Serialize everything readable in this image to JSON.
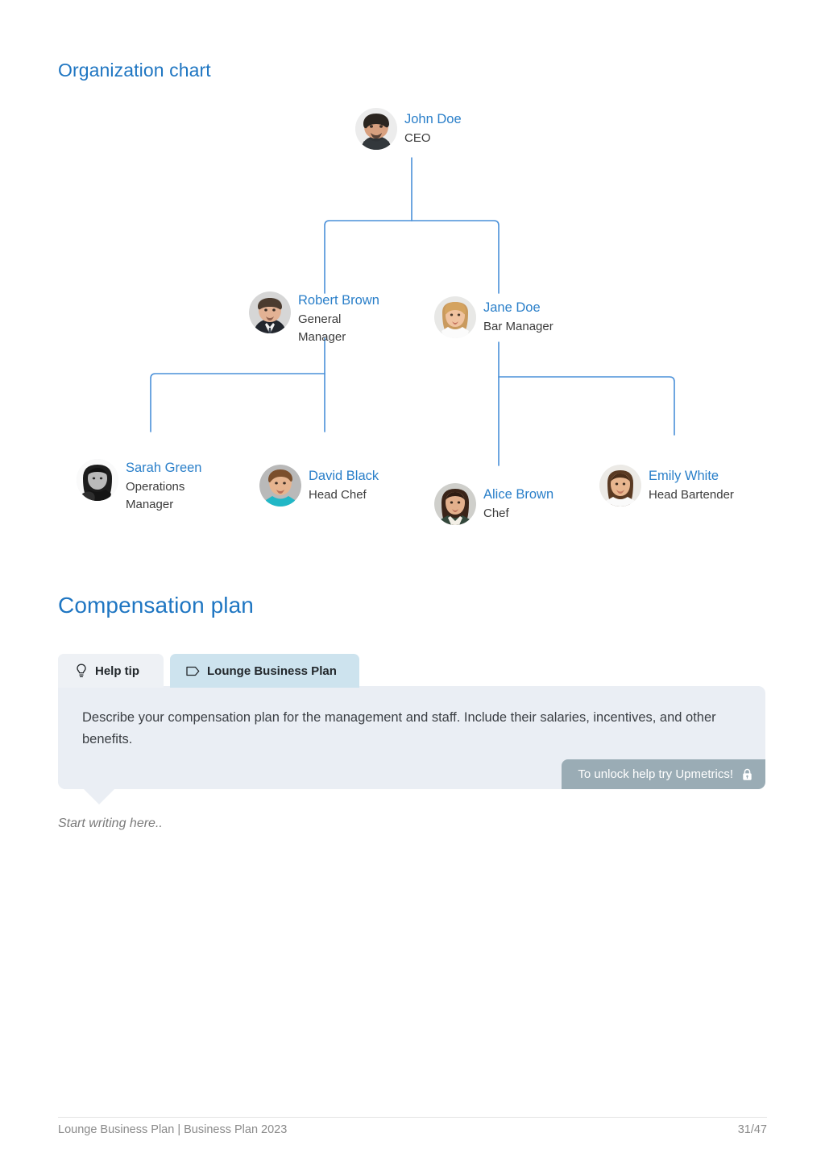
{
  "sections": {
    "org_title": "Organization chart",
    "comp_title": "Compensation plan"
  },
  "org_chart": {
    "nodes": {
      "ceo": {
        "name": "John Doe",
        "role": "CEO"
      },
      "gm": {
        "name": "Robert Brown",
        "role": "General Manager"
      },
      "bar_mgr": {
        "name": "Jane Doe",
        "role": "Bar Manager"
      },
      "ops_mgr": {
        "name": "Sarah Green",
        "role": "Operations Manager"
      },
      "head_chef": {
        "name": "David Black",
        "role": "Head Chef"
      },
      "chef": {
        "name": "Alice Brown",
        "role": "Chef"
      },
      "bartender": {
        "name": "Emily White",
        "role": "Head Bartender"
      }
    },
    "line_color": "#4a90d9",
    "name_color": "#2a7fc9"
  },
  "help_panel": {
    "tabs": [
      {
        "label": "Help tip",
        "icon": "lightbulb-icon",
        "active": false
      },
      {
        "label": "Lounge Business Plan",
        "icon": "tag-icon",
        "active": true
      }
    ],
    "tip_text": "Describe your compensation plan for the management and staff. Include their salaries, incentives, and other benefits.",
    "unlock_label": "To unlock help try Upmetrics!",
    "unlock_icon": "lock-icon",
    "editor_placeholder": "Start writing here.."
  },
  "footer": {
    "left": "Lounge Business Plan | Business Plan 2023",
    "page": "31/47"
  },
  "colors": {
    "heading_blue": "#1f76c2",
    "tab_help_bg": "#eef1f5",
    "tab_plan_bg": "#cde3ee",
    "tip_bg": "#eaeef4",
    "badge_bg": "#9aacb5"
  }
}
